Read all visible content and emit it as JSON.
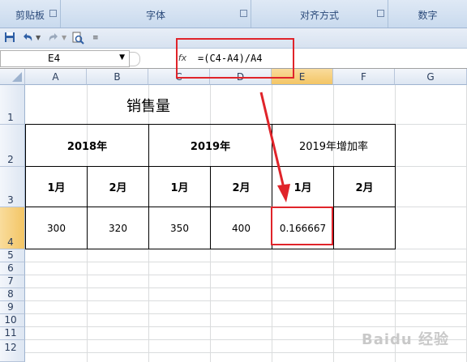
{
  "ribbon": {
    "groups": [
      "剪贴板",
      "字体",
      "对齐方式",
      "数字"
    ]
  },
  "qat": {
    "save_icon": "save-icon",
    "undo_icon": "undo-icon",
    "redo_icon": "redo-icon",
    "preview_icon": "print-preview-icon",
    "customize_icon": "customize-icon"
  },
  "formula_bar": {
    "name_box": "E4",
    "fx_label": "fx",
    "formula": "=(C4-A4)/A4"
  },
  "columns": [
    "A",
    "B",
    "C",
    "D",
    "E",
    "F",
    "G"
  ],
  "rows": [
    "1",
    "2",
    "3",
    "4",
    "5",
    "6",
    "7",
    "8",
    "9",
    "10",
    "11",
    "12"
  ],
  "sheet": {
    "title": "销售量",
    "year2018": "2018年",
    "year2019": "2019年",
    "growth": "2019年增加率",
    "months": [
      "1月",
      "2月",
      "1月",
      "2月",
      "1月",
      "2月"
    ],
    "values": [
      "300",
      "320",
      "350",
      "400",
      "0.166667",
      ""
    ]
  },
  "annotation_color": "#e0242a",
  "watermark": "Baidu 经验"
}
